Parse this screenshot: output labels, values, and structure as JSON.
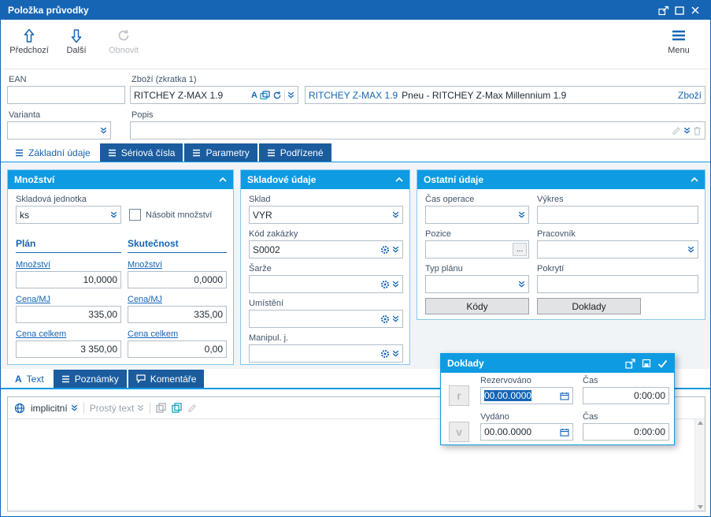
{
  "window": {
    "title": "Položka průvodky"
  },
  "toolbar": {
    "prev": "Předchozí",
    "next": "Další",
    "refresh": "Obnovit",
    "menu": "Menu"
  },
  "header": {
    "ean_label": "EAN",
    "ean_value": "",
    "product_label": "Zboží (zkratka 1)",
    "product_code": "RITCHEY Z-MAX 1.9",
    "product_flag": "A",
    "product_name_code": "RITCHEY Z-MAX 1.9",
    "product_name_rest": "Pneu - RITCHEY Z-Max Millennium 1.9",
    "product_link": "Zboží",
    "variant_label": "Varianta",
    "variant_value": "",
    "description_label": "Popis",
    "description_value": ""
  },
  "tabs": [
    "Základní údaje",
    "Sériová čísla",
    "Parametry",
    "Podřízené"
  ],
  "quantity_panel": {
    "title": "Množství",
    "unit_label": "Skladová jednotka",
    "unit_value": "ks",
    "multiply_label": "Násobit množství",
    "plan_title": "Plán",
    "actual_title": "Skutečnost",
    "rows": [
      {
        "label": "Množství",
        "plan": "10,0000",
        "actual": "0,0000"
      },
      {
        "label": "Cena/MJ",
        "plan": "335,00",
        "actual": "335,00"
      },
      {
        "label": "Cena celkem",
        "plan": "3 350,00",
        "actual": "0,00"
      }
    ]
  },
  "stock_panel": {
    "title": "Skladové údaje",
    "sklad_label": "Sklad",
    "sklad_value": "VYR",
    "zakazka_label": "Kód zakázky",
    "zakazka_value": "S0002",
    "sarze_label": "Šarže",
    "sarze_value": "",
    "umisteni_label": "Umístění",
    "umisteni_value": "",
    "manipul_label": "Manipul. j.",
    "manipul_value": ""
  },
  "other_panel": {
    "title": "Ostatní údaje",
    "cas_operace_label": "Čas operace",
    "cas_operace_value": "",
    "vykres_label": "Výkres",
    "vykres_value": "",
    "pozice_label": "Pozice",
    "pozice_value": "",
    "pozice_more": "...",
    "pracovnik_label": "Pracovník",
    "pracovnik_value": "",
    "typ_planu_label": "Typ plánu",
    "typ_planu_value": "",
    "pokryti_label": "Pokrytí",
    "pokryti_value": "",
    "kody_button": "Kódy",
    "doklady_button": "Doklady"
  },
  "doklady_popup": {
    "title": "Doklady",
    "reserved_letter": "r",
    "reserved_label": "Rezervováno",
    "reserved_date": "00.00.0000",
    "time_label": "Čas",
    "reserved_time": "0:00:00",
    "issued_letter": "v",
    "issued_label": "Vydáno",
    "issued_date": "00.00.0000",
    "issued_time": "0:00:00"
  },
  "bottom_tabs": [
    "Text",
    "Poznámky",
    "Komentáře"
  ],
  "editor": {
    "text_icon": "A",
    "language": "implicitní",
    "format": "Prostý text",
    "content": ""
  }
}
